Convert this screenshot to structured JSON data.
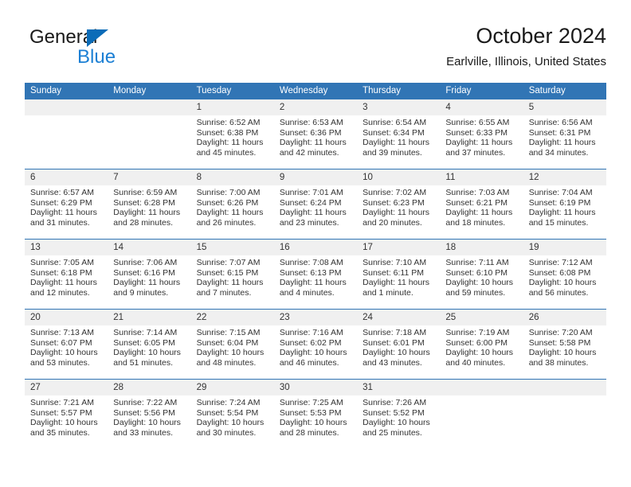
{
  "brand": {
    "name_top": "General",
    "name_bottom": "Blue",
    "triangle_color": "#0b6cb8",
    "blue_text_color": "#1b7fd4"
  },
  "header": {
    "title": "October 2024",
    "subtitle": "Earlville, Illinois, United States"
  },
  "theme": {
    "header_blue": "#3175b5",
    "daynum_bg": "#f0f0f0",
    "text": "#333333"
  },
  "weekday_headers": [
    "Sunday",
    "Monday",
    "Tuesday",
    "Wednesday",
    "Thursday",
    "Friday",
    "Saturday"
  ],
  "labels": {
    "sunrise_prefix": "Sunrise:",
    "sunset_prefix": "Sunset:",
    "daylight_prefix": "Daylight:"
  },
  "weeks": [
    [
      {
        "day": "",
        "sunrise": "",
        "sunset": "",
        "daylight_line1": "",
        "daylight_line2": "",
        "empty": true
      },
      {
        "day": "",
        "sunrise": "",
        "sunset": "",
        "daylight_line1": "",
        "daylight_line2": "",
        "empty": true
      },
      {
        "day": "1",
        "sunrise": "Sunrise: 6:52 AM",
        "sunset": "Sunset: 6:38 PM",
        "daylight_line1": "Daylight: 11 hours",
        "daylight_line2": "and 45 minutes.",
        "empty": false
      },
      {
        "day": "2",
        "sunrise": "Sunrise: 6:53 AM",
        "sunset": "Sunset: 6:36 PM",
        "daylight_line1": "Daylight: 11 hours",
        "daylight_line2": "and 42 minutes.",
        "empty": false
      },
      {
        "day": "3",
        "sunrise": "Sunrise: 6:54 AM",
        "sunset": "Sunset: 6:34 PM",
        "daylight_line1": "Daylight: 11 hours",
        "daylight_line2": "and 39 minutes.",
        "empty": false
      },
      {
        "day": "4",
        "sunrise": "Sunrise: 6:55 AM",
        "sunset": "Sunset: 6:33 PM",
        "daylight_line1": "Daylight: 11 hours",
        "daylight_line2": "and 37 minutes.",
        "empty": false
      },
      {
        "day": "5",
        "sunrise": "Sunrise: 6:56 AM",
        "sunset": "Sunset: 6:31 PM",
        "daylight_line1": "Daylight: 11 hours",
        "daylight_line2": "and 34 minutes.",
        "empty": false
      }
    ],
    [
      {
        "day": "6",
        "sunrise": "Sunrise: 6:57 AM",
        "sunset": "Sunset: 6:29 PM",
        "daylight_line1": "Daylight: 11 hours",
        "daylight_line2": "and 31 minutes.",
        "empty": false
      },
      {
        "day": "7",
        "sunrise": "Sunrise: 6:59 AM",
        "sunset": "Sunset: 6:28 PM",
        "daylight_line1": "Daylight: 11 hours",
        "daylight_line2": "and 28 minutes.",
        "empty": false
      },
      {
        "day": "8",
        "sunrise": "Sunrise: 7:00 AM",
        "sunset": "Sunset: 6:26 PM",
        "daylight_line1": "Daylight: 11 hours",
        "daylight_line2": "and 26 minutes.",
        "empty": false
      },
      {
        "day": "9",
        "sunrise": "Sunrise: 7:01 AM",
        "sunset": "Sunset: 6:24 PM",
        "daylight_line1": "Daylight: 11 hours",
        "daylight_line2": "and 23 minutes.",
        "empty": false
      },
      {
        "day": "10",
        "sunrise": "Sunrise: 7:02 AM",
        "sunset": "Sunset: 6:23 PM",
        "daylight_line1": "Daylight: 11 hours",
        "daylight_line2": "and 20 minutes.",
        "empty": false
      },
      {
        "day": "11",
        "sunrise": "Sunrise: 7:03 AM",
        "sunset": "Sunset: 6:21 PM",
        "daylight_line1": "Daylight: 11 hours",
        "daylight_line2": "and 18 minutes.",
        "empty": false
      },
      {
        "day": "12",
        "sunrise": "Sunrise: 7:04 AM",
        "sunset": "Sunset: 6:19 PM",
        "daylight_line1": "Daylight: 11 hours",
        "daylight_line2": "and 15 minutes.",
        "empty": false
      }
    ],
    [
      {
        "day": "13",
        "sunrise": "Sunrise: 7:05 AM",
        "sunset": "Sunset: 6:18 PM",
        "daylight_line1": "Daylight: 11 hours",
        "daylight_line2": "and 12 minutes.",
        "empty": false
      },
      {
        "day": "14",
        "sunrise": "Sunrise: 7:06 AM",
        "sunset": "Sunset: 6:16 PM",
        "daylight_line1": "Daylight: 11 hours",
        "daylight_line2": "and 9 minutes.",
        "empty": false
      },
      {
        "day": "15",
        "sunrise": "Sunrise: 7:07 AM",
        "sunset": "Sunset: 6:15 PM",
        "daylight_line1": "Daylight: 11 hours",
        "daylight_line2": "and 7 minutes.",
        "empty": false
      },
      {
        "day": "16",
        "sunrise": "Sunrise: 7:08 AM",
        "sunset": "Sunset: 6:13 PM",
        "daylight_line1": "Daylight: 11 hours",
        "daylight_line2": "and 4 minutes.",
        "empty": false
      },
      {
        "day": "17",
        "sunrise": "Sunrise: 7:10 AM",
        "sunset": "Sunset: 6:11 PM",
        "daylight_line1": "Daylight: 11 hours",
        "daylight_line2": "and 1 minute.",
        "empty": false
      },
      {
        "day": "18",
        "sunrise": "Sunrise: 7:11 AM",
        "sunset": "Sunset: 6:10 PM",
        "daylight_line1": "Daylight: 10 hours",
        "daylight_line2": "and 59 minutes.",
        "empty": false
      },
      {
        "day": "19",
        "sunrise": "Sunrise: 7:12 AM",
        "sunset": "Sunset: 6:08 PM",
        "daylight_line1": "Daylight: 10 hours",
        "daylight_line2": "and 56 minutes.",
        "empty": false
      }
    ],
    [
      {
        "day": "20",
        "sunrise": "Sunrise: 7:13 AM",
        "sunset": "Sunset: 6:07 PM",
        "daylight_line1": "Daylight: 10 hours",
        "daylight_line2": "and 53 minutes.",
        "empty": false
      },
      {
        "day": "21",
        "sunrise": "Sunrise: 7:14 AM",
        "sunset": "Sunset: 6:05 PM",
        "daylight_line1": "Daylight: 10 hours",
        "daylight_line2": "and 51 minutes.",
        "empty": false
      },
      {
        "day": "22",
        "sunrise": "Sunrise: 7:15 AM",
        "sunset": "Sunset: 6:04 PM",
        "daylight_line1": "Daylight: 10 hours",
        "daylight_line2": "and 48 minutes.",
        "empty": false
      },
      {
        "day": "23",
        "sunrise": "Sunrise: 7:16 AM",
        "sunset": "Sunset: 6:02 PM",
        "daylight_line1": "Daylight: 10 hours",
        "daylight_line2": "and 46 minutes.",
        "empty": false
      },
      {
        "day": "24",
        "sunrise": "Sunrise: 7:18 AM",
        "sunset": "Sunset: 6:01 PM",
        "daylight_line1": "Daylight: 10 hours",
        "daylight_line2": "and 43 minutes.",
        "empty": false
      },
      {
        "day": "25",
        "sunrise": "Sunrise: 7:19 AM",
        "sunset": "Sunset: 6:00 PM",
        "daylight_line1": "Daylight: 10 hours",
        "daylight_line2": "and 40 minutes.",
        "empty": false
      },
      {
        "day": "26",
        "sunrise": "Sunrise: 7:20 AM",
        "sunset": "Sunset: 5:58 PM",
        "daylight_line1": "Daylight: 10 hours",
        "daylight_line2": "and 38 minutes.",
        "empty": false
      }
    ],
    [
      {
        "day": "27",
        "sunrise": "Sunrise: 7:21 AM",
        "sunset": "Sunset: 5:57 PM",
        "daylight_line1": "Daylight: 10 hours",
        "daylight_line2": "and 35 minutes.",
        "empty": false
      },
      {
        "day": "28",
        "sunrise": "Sunrise: 7:22 AM",
        "sunset": "Sunset: 5:56 PM",
        "daylight_line1": "Daylight: 10 hours",
        "daylight_line2": "and 33 minutes.",
        "empty": false
      },
      {
        "day": "29",
        "sunrise": "Sunrise: 7:24 AM",
        "sunset": "Sunset: 5:54 PM",
        "daylight_line1": "Daylight: 10 hours",
        "daylight_line2": "and 30 minutes.",
        "empty": false
      },
      {
        "day": "30",
        "sunrise": "Sunrise: 7:25 AM",
        "sunset": "Sunset: 5:53 PM",
        "daylight_line1": "Daylight: 10 hours",
        "daylight_line2": "and 28 minutes.",
        "empty": false
      },
      {
        "day": "31",
        "sunrise": "Sunrise: 7:26 AM",
        "sunset": "Sunset: 5:52 PM",
        "daylight_line1": "Daylight: 10 hours",
        "daylight_line2": "and 25 minutes.",
        "empty": false
      },
      {
        "day": "",
        "sunrise": "",
        "sunset": "",
        "daylight_line1": "",
        "daylight_line2": "",
        "empty": true
      },
      {
        "day": "",
        "sunrise": "",
        "sunset": "",
        "daylight_line1": "",
        "daylight_line2": "",
        "empty": true
      }
    ]
  ]
}
